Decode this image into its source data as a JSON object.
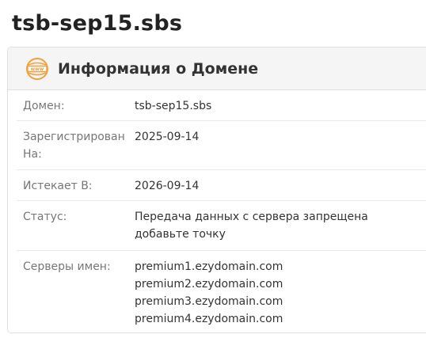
{
  "page": {
    "title": "tsb-sep15.sbs"
  },
  "card": {
    "title": "Информация о Домене",
    "icon": "www-globe-icon",
    "accent_color": "#f0a040"
  },
  "details": {
    "domain": {
      "label": "Домен:",
      "value": "tsb-sep15.sbs"
    },
    "registered": {
      "label": "Зарегистрирован На:",
      "value": "2025-09-14"
    },
    "expires": {
      "label": "Истекает В:",
      "value": "2026-09-14"
    },
    "status": {
      "label": "Статус:",
      "values": [
        "Передача данных с сервера запрещена",
        "добавьте точку"
      ]
    },
    "nameservers": {
      "label": "Серверы имен:",
      "values": [
        "premium1.ezydomain.com",
        "premium2.ezydomain.com",
        "premium3.ezydomain.com",
        "premium4.ezydomain.com"
      ]
    }
  }
}
